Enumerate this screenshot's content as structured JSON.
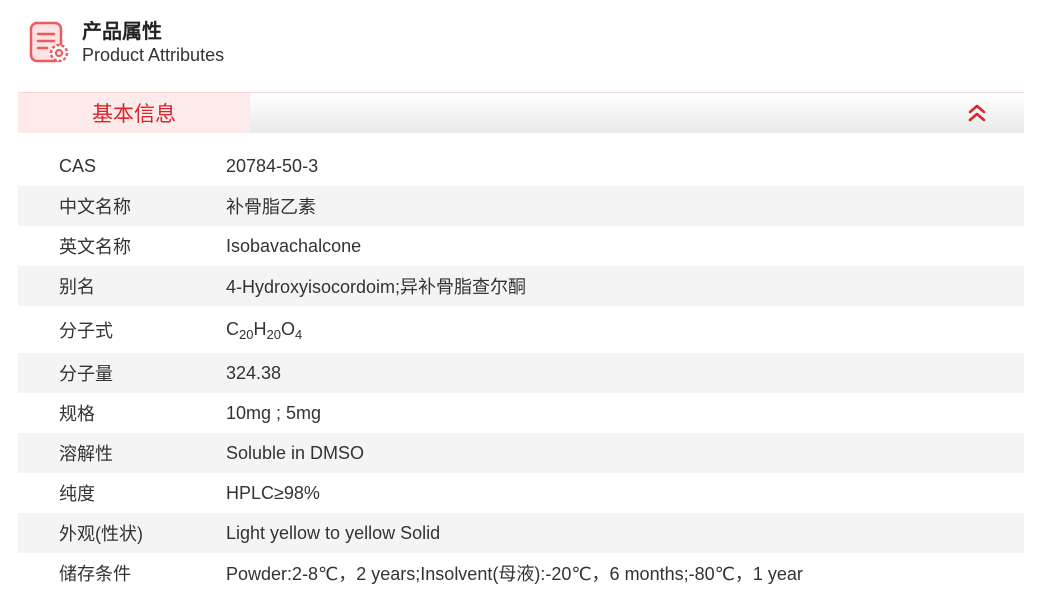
{
  "header": {
    "title_cn": "产品属性",
    "title_en": "Product Attributes"
  },
  "section": {
    "tab_label": "基本信息"
  },
  "colors": {
    "accent": "#d9252b",
    "tab_bg": "#fdeaea",
    "row_alt_bg": "#f4f4f4"
  },
  "attributes": [
    {
      "key": "CAS",
      "value": "20784-50-3"
    },
    {
      "key": "中文名称",
      "value": "补骨脂乙素"
    },
    {
      "key": "英文名称",
      "value": "Isobavachalcone"
    },
    {
      "key": "别名",
      "value": "4-Hydroxyisocordoim;异补骨脂查尔酮"
    },
    {
      "key": "分子式",
      "formula": [
        {
          "t": "C"
        },
        {
          "t": "20",
          "sub": true
        },
        {
          "t": "H"
        },
        {
          "t": "20",
          "sub": true
        },
        {
          "t": "O"
        },
        {
          "t": "4",
          "sub": true
        }
      ]
    },
    {
      "key": "分子量",
      "value": "324.38"
    },
    {
      "key": "规格",
      "value": "10mg ; 5mg"
    },
    {
      "key": "溶解性",
      "value": "Soluble in DMSO"
    },
    {
      "key": "纯度",
      "value": "HPLC≥98%"
    },
    {
      "key": "外观(性状)",
      "value": "Light yellow to yellow Solid"
    },
    {
      "key": "储存条件",
      "value": "Powder:2-8℃，2 years;Insolvent(母液):-20℃，6 months;-80℃，1 year"
    }
  ]
}
